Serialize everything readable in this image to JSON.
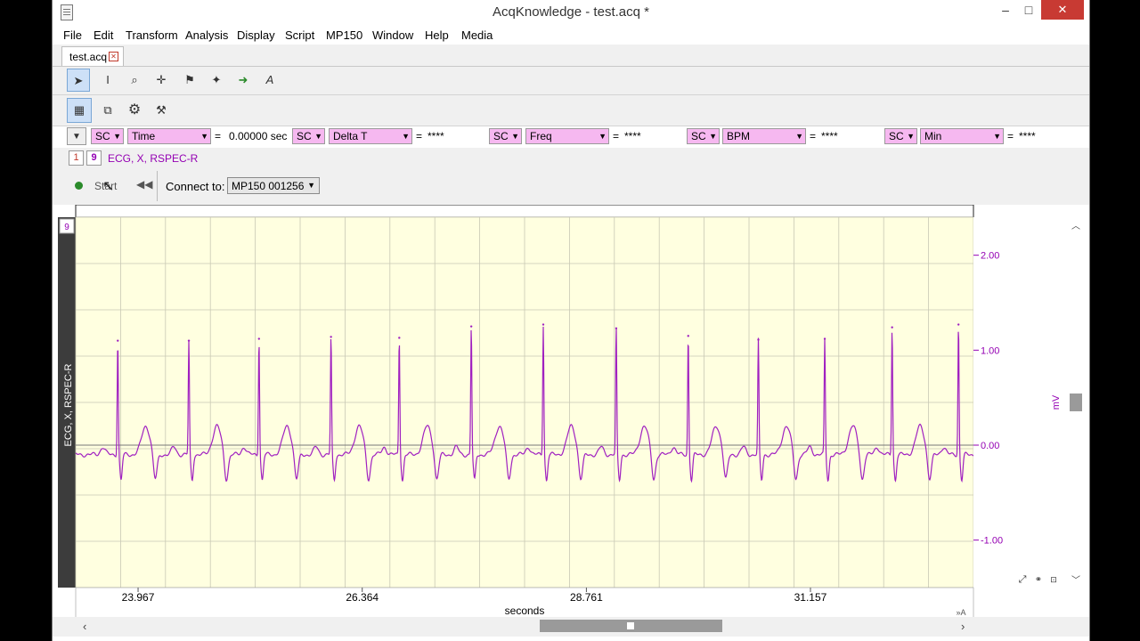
{
  "window": {
    "title": "AcqKnowledge - test.acq *",
    "min": "–",
    "max": "□",
    "close": "✕"
  },
  "menu": [
    "File",
    "Edit",
    "Transform",
    "Analysis",
    "Display",
    "Script",
    "MP150",
    "Window",
    "Help",
    "Media"
  ],
  "tab": {
    "label": "test.acq",
    "close": "✕"
  },
  "measurements": [
    {
      "channel": "SC",
      "type": "Time",
      "value": "0.00000 sec"
    },
    {
      "channel": "SC",
      "type": "Delta T",
      "value": "****"
    },
    {
      "channel": "SC",
      "type": "Freq",
      "value": "****"
    },
    {
      "channel": "SC",
      "type": "BPM",
      "value": "****"
    },
    {
      "channel": "SC",
      "type": "Min",
      "value": "****"
    }
  ],
  "equals": "=",
  "channel_bar": {
    "number": "9",
    "label": "ECG, X, RSPEC-R"
  },
  "acquisition": {
    "start_label": "Start",
    "connect_label": "Connect to:",
    "device": "MP150 001256"
  },
  "chart": {
    "channel_number": "9",
    "channel_label": "ECG, X, RSPEC-R",
    "unit": "mV",
    "xlabel": "seconds"
  },
  "chart_data": {
    "type": "line",
    "title": "",
    "xlabel": "seconds",
    "ylabel": "mV",
    "x_ticks": [
      "23.967",
      "26.364",
      "28.761",
      "31.157"
    ],
    "y_ticks": [
      "2.00",
      "1.00",
      "0.00",
      "-1.00"
    ],
    "xlim": [
      23.3,
      32.9
    ],
    "ylim": [
      -1.5,
      2.4
    ],
    "grid": true,
    "colors": {
      "trace": "#a020c0",
      "background": "#ffffe0",
      "grid": "#c8c8b4",
      "axis_text": "#9400b3"
    },
    "series": [
      {
        "name": "ECG, X, RSPEC-R",
        "r_peaks_seconds": [
          23.75,
          24.51,
          25.26,
          26.03,
          26.76,
          27.53,
          28.3,
          29.08,
          29.85,
          30.6,
          31.31,
          32.03,
          32.74
        ],
        "r_peaks_mv": [
          1.1,
          1.1,
          1.12,
          1.14,
          1.13,
          1.25,
          1.27,
          1.23,
          1.15,
          1.11,
          1.12,
          1.24,
          1.27
        ],
        "baseline_mv": -0.1,
        "t_wave_mv": 0.18,
        "s_wave_mv": -0.25
      }
    ]
  }
}
